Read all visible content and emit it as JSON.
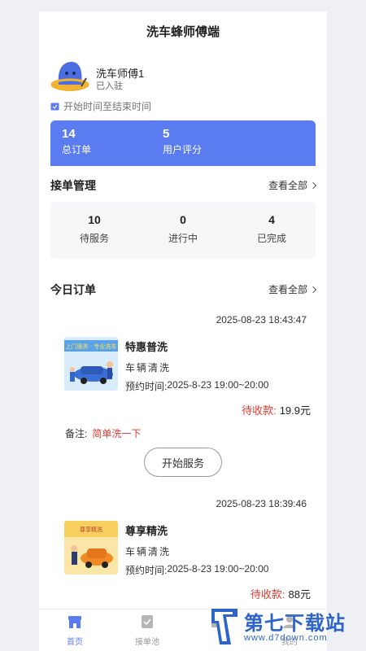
{
  "header": {
    "title": "洗车蜂师傅端"
  },
  "profile": {
    "name": "洗车师傅1",
    "status": "已入驻"
  },
  "date_range": "开始时间至结束时间",
  "stats": [
    {
      "value": "14",
      "label": "总订单"
    },
    {
      "value": "5",
      "label": "用户评分"
    }
  ],
  "accept": {
    "title": "接单管理",
    "view_all": "查看全部",
    "items": [
      {
        "value": "10",
        "label": "待服务"
      },
      {
        "value": "0",
        "label": "进行中"
      },
      {
        "value": "4",
        "label": "已完成"
      }
    ]
  },
  "today": {
    "title": "今日订单",
    "view_all": "查看全部",
    "orders": [
      {
        "time": "2025-08-23 18:43:47",
        "name": "特惠普洗",
        "vehicle": "车辆清洗",
        "appt_label": "预约时间:",
        "appt_value": "2025-8-23 19:00~20:00",
        "pending_label": "待收款:",
        "price": "19.9元",
        "note_label": "备注:",
        "note_value": "简单洗一下",
        "action": "开始服务",
        "thumb_text": "上门服务 · 专业洗车"
      },
      {
        "time": "2025-08-23 18:39:46",
        "name": "尊享精洗",
        "vehicle": "车辆清洗",
        "appt_label": "预约时间:",
        "appt_value": "2025-8-23 19:00~20:00",
        "pending_label": "待收款:",
        "price": "88元",
        "thumb_text": "尊享精洗"
      }
    ]
  },
  "tabbar": [
    {
      "label": "首页",
      "icon": "store-icon",
      "active": true
    },
    {
      "label": "接单池",
      "icon": "clipboard-check-icon",
      "active": false
    },
    {
      "label": "",
      "icon": "folder-icon",
      "active": false
    },
    {
      "label": "我的",
      "icon": "user-icon",
      "active": false
    }
  ],
  "watermark": {
    "text": "第七下载站",
    "url": "www.d7down.com"
  },
  "colors": {
    "accent": "#5b7cf0",
    "price_red": "#e23a2e",
    "watermark": "#2d64c8"
  }
}
